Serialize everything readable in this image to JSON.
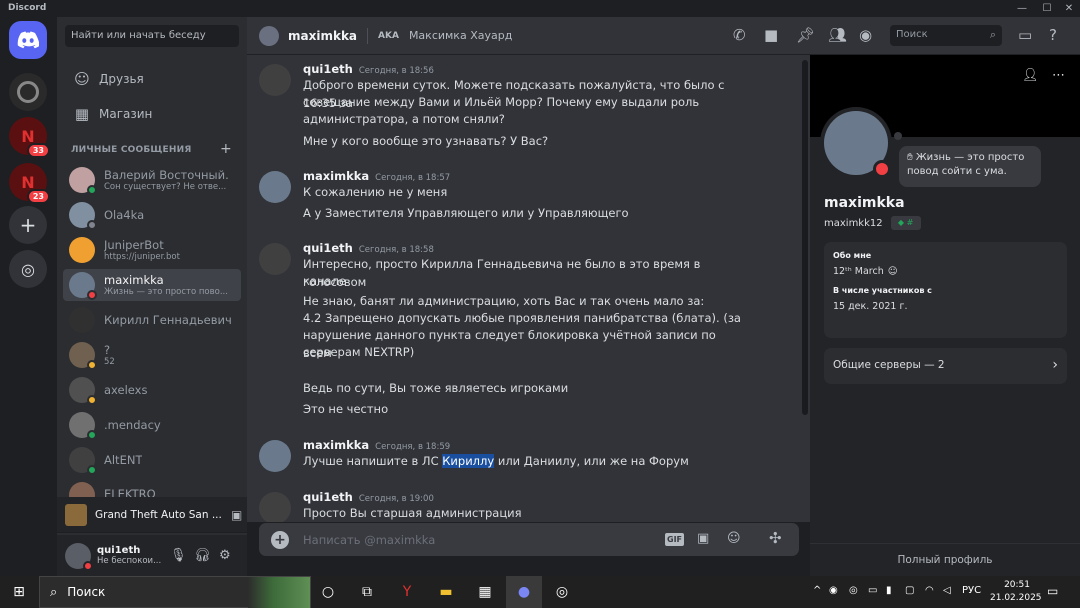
{
  "window": {
    "title": "Discord"
  },
  "servers": [
    {
      "badge": ""
    },
    {
      "badge": "33"
    },
    {
      "badge": "23"
    }
  ],
  "dm_panel": {
    "search_placeholder": "Найти или начать беседу",
    "nav": [
      {
        "label": "Друзья"
      },
      {
        "label": "Магазин"
      }
    ],
    "header": "ЛИЧНЫЕ СООБЩЕНИЯ",
    "items": [
      {
        "name": "Валерий Восточный.",
        "sub": "Сон существует? Не отве...",
        "status": "online",
        "color": "#c0a0a0"
      },
      {
        "name": "Ola4ka",
        "sub": "",
        "status": "offline",
        "color": "#8090a0"
      },
      {
        "name": "JuniperBot",
        "sub": "https://juniper.bot",
        "status": "",
        "color": "#f0a030"
      },
      {
        "name": "maximkka",
        "sub": "Жизнь — это просто пово...",
        "status": "dnd",
        "color": "#6a7a8c"
      },
      {
        "name": "Кирилл Геннадьевич",
        "sub": "",
        "status": "",
        "color": "#303030"
      },
      {
        "name": "?",
        "sub": "52",
        "status": "idle",
        "color": "#706050"
      },
      {
        "name": "axelexs",
        "sub": "",
        "status": "idle",
        "color": "#505050"
      },
      {
        "name": ".mendacy",
        "sub": "",
        "status": "online",
        "color": "#707070"
      },
      {
        "name": "AltENT",
        "sub": "",
        "status": "online",
        "color": "#404040"
      },
      {
        "name": "ELEKTRO",
        "sub": "",
        "status": "",
        "color": "#806050"
      }
    ],
    "activity": "Grand Theft Auto San ...",
    "user": {
      "name": "qui1eth",
      "status": "Не беспокои..."
    }
  },
  "topbar": {
    "name": "maximkka",
    "aka_label": "AKA",
    "real_name": "Максимка Хауард",
    "search_placeholder": "Поиск"
  },
  "messages": [
    {
      "author": "qui1eth",
      "time": "Сегодня, в 18:56",
      "lines": [
        "Доброго времени суток. Можете подсказать пожалуйста, что было с 16:35 за",
        "совещание между Вами и Ильёй Морр? Почему ему выдали роль",
        "администратора, а потом сняли?",
        "Мне у кого вообще это узнавать? У Вас?"
      ]
    },
    {
      "author": "maximkka",
      "time": "Сегодня, в 18:57",
      "lines": [
        "К сожалению не у меня",
        "А у Заместителя Управляющего или у Управляющего"
      ]
    },
    {
      "author": "qui1eth",
      "time": "Сегодня, в 18:58",
      "lines": [
        "Интересно, просто Кирилла Геннадьевича не было в это время в голосовом",
        "канале",
        "Не знаю, банят ли администрацию, хоть Вас и так очень мало за:",
        "4.2 Запрещено допускать любые проявления панибратства (блата). (за",
        "нарушение данного пункта следует блокировка учётной записи по всем",
        "серверам NEXTRP)",
        "Ведь по сути, Вы тоже являетесь игроками",
        "Это не честно"
      ]
    },
    {
      "author": "maximkka",
      "time": "Сегодня, в 18:59",
      "line_pre": "Лучше напишите в ЛС ",
      "line_hl": "Кириллу",
      "line_post": " или Даниилу, или же на Форум"
    },
    {
      "author": "qui1eth",
      "time": "Сегодня, в 19:00",
      "lines": [
        "Просто Вы старшая администрация"
      ]
    }
  ],
  "composer": {
    "placeholder": "Написать @maximkka",
    "gif": "GIF"
  },
  "profile": {
    "status": "Жизнь — это просто повод сойти с ума.",
    "display_name": "maximkka",
    "username": "maximkk12",
    "about_label": "Обо мне",
    "about_value": "12ᵗʰ March",
    "member_since_label": "В числе участников с",
    "member_since_value": "15 дек. 2021 г.",
    "mutual_servers": "Общие серверы — 2",
    "full_profile": "Полный профиль"
  },
  "taskbar": {
    "search": "Поиск",
    "lang": "РУС",
    "time": "20:51",
    "date": "21.02.2025"
  },
  "colors": {
    "accent": "#5865f2",
    "dnd": "#f23f43",
    "online": "#23a55a",
    "idle": "#f0b232"
  }
}
